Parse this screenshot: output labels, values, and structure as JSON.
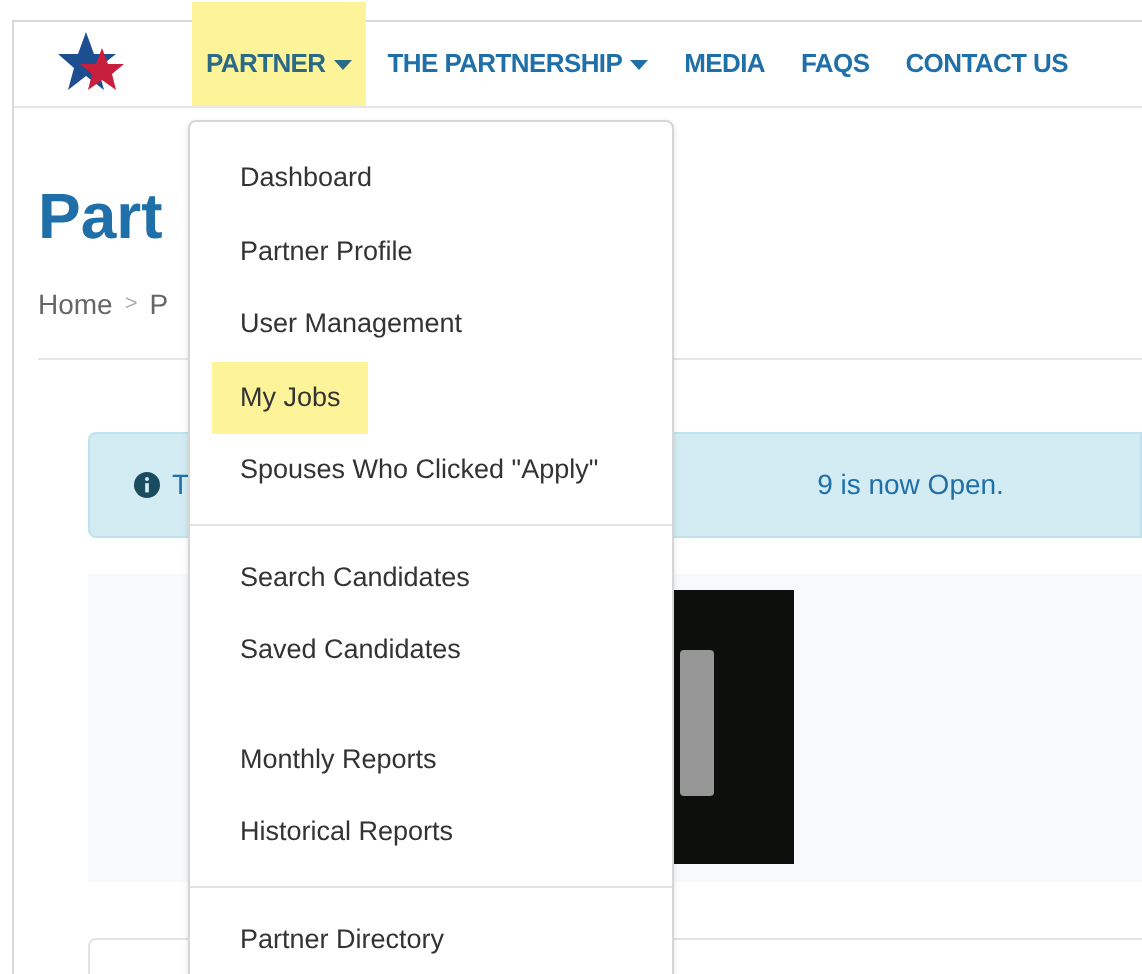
{
  "nav": {
    "items": [
      {
        "label": "PARTNER",
        "selected": true,
        "caret": true
      },
      {
        "label": "THE PARTNERSHIP",
        "selected": false,
        "caret": true
      },
      {
        "label": "MEDIA",
        "selected": false,
        "caret": false
      },
      {
        "label": "FAQS",
        "selected": false,
        "caret": false
      },
      {
        "label": "CONTACT US",
        "selected": false,
        "caret": false
      }
    ]
  },
  "page": {
    "title": "Part",
    "breadcrumb": [
      "Home",
      "P"
    ],
    "breadcrumb_separator": ">",
    "alert": {
      "start": "T",
      "end": "9 is now Open."
    }
  },
  "menu": {
    "entries": [
      {
        "kind": "item",
        "label": "Dashboard",
        "selected": false
      },
      {
        "kind": "item",
        "label": "Partner Profile",
        "selected": false
      },
      {
        "kind": "item",
        "label": "User Management",
        "selected": false
      },
      {
        "kind": "item",
        "label": "My Jobs",
        "selected": true
      },
      {
        "kind": "item",
        "label": "Spouses Who Clicked \"Apply\"",
        "selected": false
      },
      {
        "kind": "divider"
      },
      {
        "kind": "item",
        "label": "Search Candidates",
        "selected": false
      },
      {
        "kind": "item",
        "label": "Saved Candidates",
        "selected": false
      },
      {
        "kind": "gap"
      },
      {
        "kind": "item",
        "label": "Monthly Reports",
        "selected": false
      },
      {
        "kind": "item",
        "label": "Historical Reports",
        "selected": false
      },
      {
        "kind": "divider"
      },
      {
        "kind": "item",
        "label": "Partner Directory",
        "selected": false
      }
    ]
  }
}
